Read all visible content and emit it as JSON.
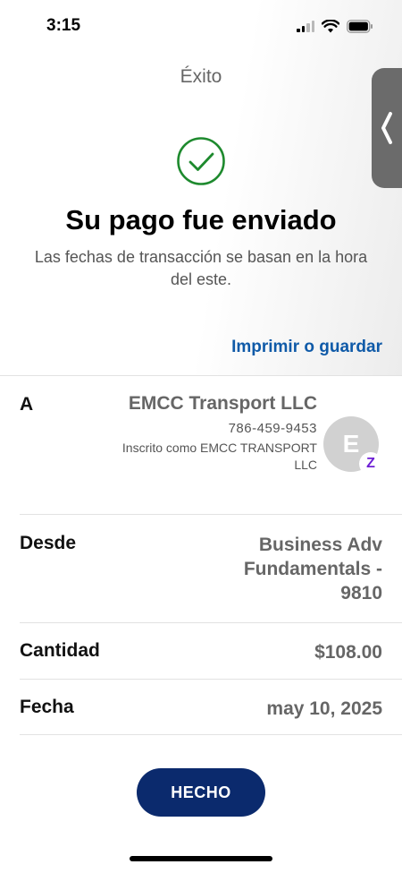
{
  "status_bar": {
    "time": "3:15",
    "icons": [
      "signal-icon",
      "wifi-icon",
      "battery-icon"
    ]
  },
  "header": {
    "title": "Éxito"
  },
  "confirmation": {
    "headline": "Su pago fue enviado",
    "subtext": "Las fechas de transacción se basan en la hora del este.",
    "print_link": "Imprimir o guardar",
    "icon": "check-circle-icon",
    "icon_color": "#1e8a2e"
  },
  "details": {
    "to": {
      "label": "A",
      "name": "EMCC Transport LLC",
      "phone": "786-459-9453",
      "enrolled": "Inscrito como EMCC TRANSPORT LLC",
      "avatar_letter": "E",
      "badge_icon": "zelle-icon",
      "badge_glyph": "Z"
    },
    "from": {
      "label": "Desde",
      "value": "Business Adv Fundamentals - 9810"
    },
    "amount": {
      "label": "Cantidad",
      "value": "$108.00"
    },
    "date": {
      "label": "Fecha",
      "value": "may 10, 2025"
    }
  },
  "actions": {
    "done_label": "HECHO",
    "done_color": "#0b2a6d",
    "link_color": "#0f5aa8"
  },
  "side_tab": {
    "icon": "chevron-left-icon"
  }
}
